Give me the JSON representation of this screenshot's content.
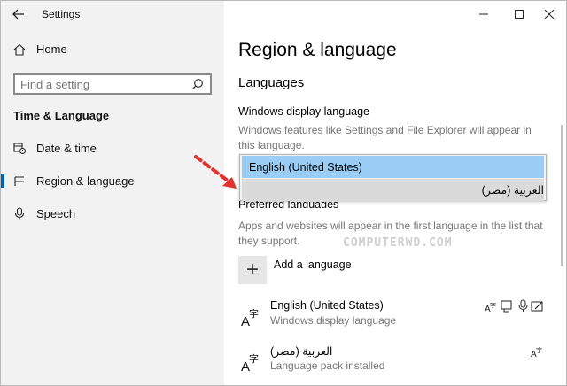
{
  "window": {
    "app_title": "Settings",
    "back_icon": "arrow-left-icon",
    "minimize_icon": "minimize-icon",
    "maximize_icon": "maximize-icon",
    "close_icon": "close-icon"
  },
  "sidebar": {
    "home_label": "Home",
    "search_placeholder": "Find a setting",
    "section_title": "Time & Language",
    "items": [
      {
        "label": "Date & time",
        "icon": "calendar-clock-icon",
        "active": false
      },
      {
        "label": "Region & language",
        "icon": "region-icon",
        "active": true
      },
      {
        "label": "Speech",
        "icon": "microphone-icon",
        "active": false
      }
    ]
  },
  "main": {
    "title": "Region & language",
    "languages_heading": "Languages",
    "display_language_label": "Windows display language",
    "display_language_desc": "Windows features like Settings and File Explorer will appear in this language.",
    "dropdown_options": [
      {
        "label": "English (United States)",
        "state": "selected"
      },
      {
        "label": "العربية (مصر)",
        "state": "hover"
      }
    ],
    "preferred_label": "Preferred languages",
    "preferred_desc": "Apps and websites will appear in the first language in the list that they support.",
    "add_language_label": "Add a language",
    "languages": [
      {
        "name": "English (United States)",
        "status": "Windows display language",
        "features": [
          "display-language-icon",
          "speech-recognition-icon",
          "text-to-speech-icon",
          "handwriting-icon"
        ]
      },
      {
        "name": "العربية (مصر)",
        "status": "Language pack installed",
        "features": [
          "display-language-icon"
        ]
      }
    ]
  },
  "watermark": "COMPUTERWD.COM",
  "colors": {
    "accent": "#0063b1",
    "selected_option": "#99cdf5",
    "arrow": "#e0332b"
  }
}
